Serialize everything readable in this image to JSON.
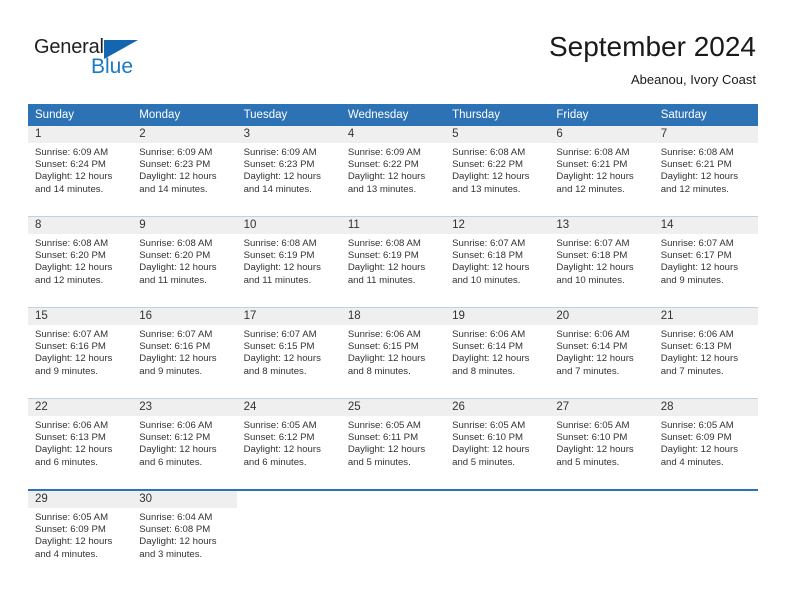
{
  "brand": {
    "name_part1": "General",
    "name_part2": "Blue",
    "triangle_color": "#1466b0",
    "blue_color": "#1a7ac4",
    "dark_color": "#231f20"
  },
  "header": {
    "title": "September 2024",
    "subtitle": "Abeanou, Ivory Coast"
  },
  "theme": {
    "header_row_bg": "#2c72b5",
    "daynum_band_bg": "#efefef",
    "row_divider": "#bfd1e3",
    "text_color": "#333333"
  },
  "weekday_headers": [
    "Sunday",
    "Monday",
    "Tuesday",
    "Wednesday",
    "Thursday",
    "Friday",
    "Saturday"
  ],
  "weeks": [
    {
      "days": [
        {
          "num": "1",
          "sunrise": "Sunrise: 6:09 AM",
          "sunset": "Sunset: 6:24 PM",
          "daylight1": "Daylight: 12 hours",
          "daylight2": "and 14 minutes."
        },
        {
          "num": "2",
          "sunrise": "Sunrise: 6:09 AM",
          "sunset": "Sunset: 6:23 PM",
          "daylight1": "Daylight: 12 hours",
          "daylight2": "and 14 minutes."
        },
        {
          "num": "3",
          "sunrise": "Sunrise: 6:09 AM",
          "sunset": "Sunset: 6:23 PM",
          "daylight1": "Daylight: 12 hours",
          "daylight2": "and 14 minutes."
        },
        {
          "num": "4",
          "sunrise": "Sunrise: 6:09 AM",
          "sunset": "Sunset: 6:22 PM",
          "daylight1": "Daylight: 12 hours",
          "daylight2": "and 13 minutes."
        },
        {
          "num": "5",
          "sunrise": "Sunrise: 6:08 AM",
          "sunset": "Sunset: 6:22 PM",
          "daylight1": "Daylight: 12 hours",
          "daylight2": "and 13 minutes."
        },
        {
          "num": "6",
          "sunrise": "Sunrise: 6:08 AM",
          "sunset": "Sunset: 6:21 PM",
          "daylight1": "Daylight: 12 hours",
          "daylight2": "and 12 minutes."
        },
        {
          "num": "7",
          "sunrise": "Sunrise: 6:08 AM",
          "sunset": "Sunset: 6:21 PM",
          "daylight1": "Daylight: 12 hours",
          "daylight2": "and 12 minutes."
        }
      ]
    },
    {
      "days": [
        {
          "num": "8",
          "sunrise": "Sunrise: 6:08 AM",
          "sunset": "Sunset: 6:20 PM",
          "daylight1": "Daylight: 12 hours",
          "daylight2": "and 12 minutes."
        },
        {
          "num": "9",
          "sunrise": "Sunrise: 6:08 AM",
          "sunset": "Sunset: 6:20 PM",
          "daylight1": "Daylight: 12 hours",
          "daylight2": "and 11 minutes."
        },
        {
          "num": "10",
          "sunrise": "Sunrise: 6:08 AM",
          "sunset": "Sunset: 6:19 PM",
          "daylight1": "Daylight: 12 hours",
          "daylight2": "and 11 minutes."
        },
        {
          "num": "11",
          "sunrise": "Sunrise: 6:08 AM",
          "sunset": "Sunset: 6:19 PM",
          "daylight1": "Daylight: 12 hours",
          "daylight2": "and 11 minutes."
        },
        {
          "num": "12",
          "sunrise": "Sunrise: 6:07 AM",
          "sunset": "Sunset: 6:18 PM",
          "daylight1": "Daylight: 12 hours",
          "daylight2": "and 10 minutes."
        },
        {
          "num": "13",
          "sunrise": "Sunrise: 6:07 AM",
          "sunset": "Sunset: 6:18 PM",
          "daylight1": "Daylight: 12 hours",
          "daylight2": "and 10 minutes."
        },
        {
          "num": "14",
          "sunrise": "Sunrise: 6:07 AM",
          "sunset": "Sunset: 6:17 PM",
          "daylight1": "Daylight: 12 hours",
          "daylight2": "and 9 minutes."
        }
      ]
    },
    {
      "days": [
        {
          "num": "15",
          "sunrise": "Sunrise: 6:07 AM",
          "sunset": "Sunset: 6:16 PM",
          "daylight1": "Daylight: 12 hours",
          "daylight2": "and 9 minutes."
        },
        {
          "num": "16",
          "sunrise": "Sunrise: 6:07 AM",
          "sunset": "Sunset: 6:16 PM",
          "daylight1": "Daylight: 12 hours",
          "daylight2": "and 9 minutes."
        },
        {
          "num": "17",
          "sunrise": "Sunrise: 6:07 AM",
          "sunset": "Sunset: 6:15 PM",
          "daylight1": "Daylight: 12 hours",
          "daylight2": "and 8 minutes."
        },
        {
          "num": "18",
          "sunrise": "Sunrise: 6:06 AM",
          "sunset": "Sunset: 6:15 PM",
          "daylight1": "Daylight: 12 hours",
          "daylight2": "and 8 minutes."
        },
        {
          "num": "19",
          "sunrise": "Sunrise: 6:06 AM",
          "sunset": "Sunset: 6:14 PM",
          "daylight1": "Daylight: 12 hours",
          "daylight2": "and 8 minutes."
        },
        {
          "num": "20",
          "sunrise": "Sunrise: 6:06 AM",
          "sunset": "Sunset: 6:14 PM",
          "daylight1": "Daylight: 12 hours",
          "daylight2": "and 7 minutes."
        },
        {
          "num": "21",
          "sunrise": "Sunrise: 6:06 AM",
          "sunset": "Sunset: 6:13 PM",
          "daylight1": "Daylight: 12 hours",
          "daylight2": "and 7 minutes."
        }
      ]
    },
    {
      "days": [
        {
          "num": "22",
          "sunrise": "Sunrise: 6:06 AM",
          "sunset": "Sunset: 6:13 PM",
          "daylight1": "Daylight: 12 hours",
          "daylight2": "and 6 minutes."
        },
        {
          "num": "23",
          "sunrise": "Sunrise: 6:06 AM",
          "sunset": "Sunset: 6:12 PM",
          "daylight1": "Daylight: 12 hours",
          "daylight2": "and 6 minutes."
        },
        {
          "num": "24",
          "sunrise": "Sunrise: 6:05 AM",
          "sunset": "Sunset: 6:12 PM",
          "daylight1": "Daylight: 12 hours",
          "daylight2": "and 6 minutes."
        },
        {
          "num": "25",
          "sunrise": "Sunrise: 6:05 AM",
          "sunset": "Sunset: 6:11 PM",
          "daylight1": "Daylight: 12 hours",
          "daylight2": "and 5 minutes."
        },
        {
          "num": "26",
          "sunrise": "Sunrise: 6:05 AM",
          "sunset": "Sunset: 6:10 PM",
          "daylight1": "Daylight: 12 hours",
          "daylight2": "and 5 minutes."
        },
        {
          "num": "27",
          "sunrise": "Sunrise: 6:05 AM",
          "sunset": "Sunset: 6:10 PM",
          "daylight1": "Daylight: 12 hours",
          "daylight2": "and 5 minutes."
        },
        {
          "num": "28",
          "sunrise": "Sunrise: 6:05 AM",
          "sunset": "Sunset: 6:09 PM",
          "daylight1": "Daylight: 12 hours",
          "daylight2": "and 4 minutes."
        }
      ]
    },
    {
      "days": [
        {
          "num": "29",
          "sunrise": "Sunrise: 6:05 AM",
          "sunset": "Sunset: 6:09 PM",
          "daylight1": "Daylight: 12 hours",
          "daylight2": "and 4 minutes."
        },
        {
          "num": "30",
          "sunrise": "Sunrise: 6:04 AM",
          "sunset": "Sunset: 6:08 PM",
          "daylight1": "Daylight: 12 hours",
          "daylight2": "and 3 minutes."
        },
        {
          "num": "",
          "sunrise": "",
          "sunset": "",
          "daylight1": "",
          "daylight2": ""
        },
        {
          "num": "",
          "sunrise": "",
          "sunset": "",
          "daylight1": "",
          "daylight2": ""
        },
        {
          "num": "",
          "sunrise": "",
          "sunset": "",
          "daylight1": "",
          "daylight2": ""
        },
        {
          "num": "",
          "sunrise": "",
          "sunset": "",
          "daylight1": "",
          "daylight2": ""
        },
        {
          "num": "",
          "sunrise": "",
          "sunset": "",
          "daylight1": "",
          "daylight2": ""
        }
      ]
    }
  ]
}
